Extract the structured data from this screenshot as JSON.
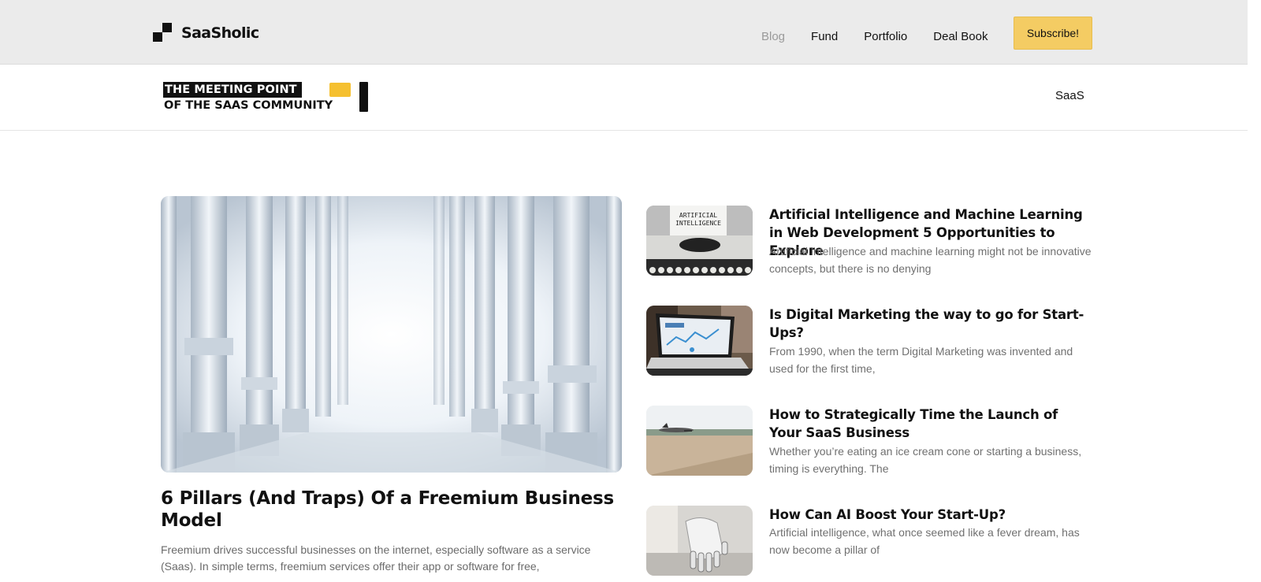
{
  "brand": {
    "name": "SaaSholic"
  },
  "nav": {
    "items": [
      {
        "label": "Blog"
      },
      {
        "label": "Fund"
      },
      {
        "label": "Portfolio"
      },
      {
        "label": "Deal Book"
      }
    ],
    "subscribe_label": "Subscribe!"
  },
  "subheader": {
    "badge_line1": "THE MEETING POINT",
    "badge_line2": "OF THE SAAS COMMUNITY",
    "category_link": "SaaS"
  },
  "featured": {
    "title": "6 Pillars (And Traps) Of a Freemium Business Model",
    "excerpt": "Freemium drives successful businesses on the internet, especially software as a service (Saas).  In simple terms, freemium services offer their app or software for free,"
  },
  "posts": [
    {
      "title": "Artificial Intelligence and Machine Learning in Web Development 5 Opportunities to Explore",
      "excerpt": "Artificial intelligence and machine learning might not be innovative concepts, but there is no denying",
      "thumb_text": "ARTIFICIAL INTELLIGENCE"
    },
    {
      "title": "Is Digital Marketing the way to go for Start-Ups?",
      "excerpt": "From 1990, when the term Digital Marketing was invented and used for the first time,"
    },
    {
      "title": "How to Strategically Time the Launch of Your SaaS Business",
      "excerpt": "Whether you’re eating an ice cream cone or starting a business, timing is everything. The"
    },
    {
      "title": "How Can AI Boost Your Start-Up?",
      "excerpt": "Artificial intelligence, what once seemed like a fever dream, has now become a pillar of"
    }
  ]
}
